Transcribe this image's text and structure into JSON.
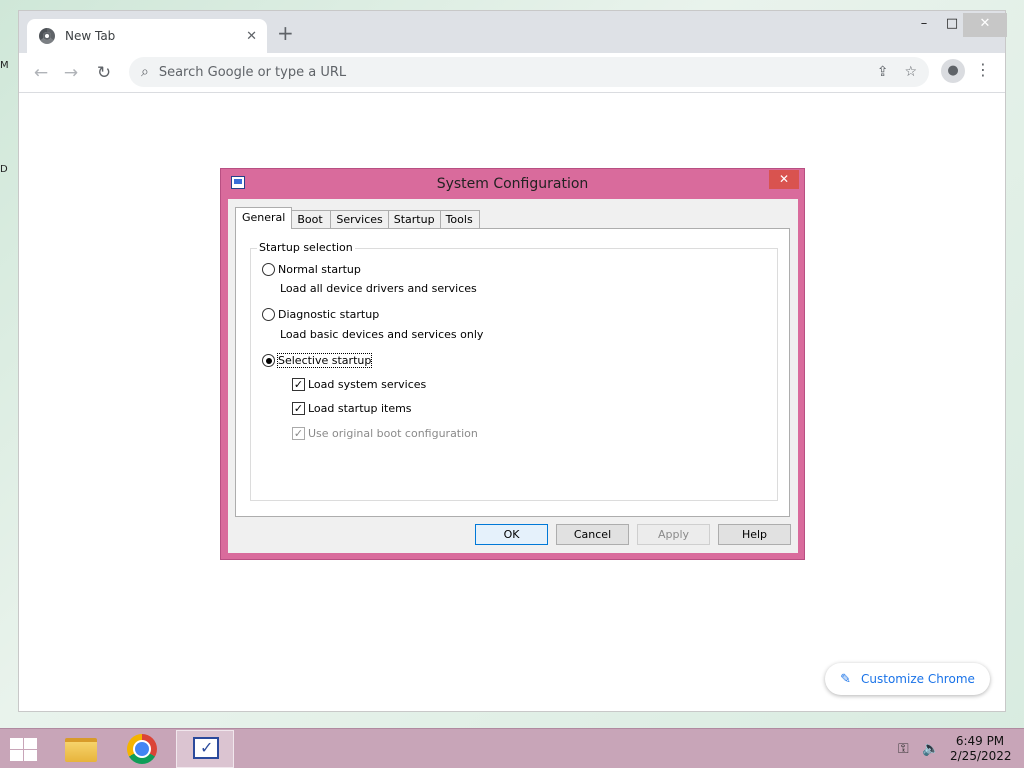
{
  "chrome": {
    "tab_title": "New Tab",
    "tab_close_glyph": "✕",
    "new_tab_glyph": "+",
    "window_controls": {
      "minimize": "–",
      "maximize": "□",
      "close": "✕"
    },
    "omnibox_placeholder": "Search Google or type a URL",
    "customize_label": "Customize Chrome",
    "icons": [
      "back-arrow-icon",
      "forward-arrow-icon",
      "reload-icon",
      "search-icon",
      "share-icon",
      "star-icon",
      "profile-icon",
      "more-menu-icon",
      "pencil-icon"
    ]
  },
  "dialog": {
    "title": "System Configuration",
    "close_glyph": "✕",
    "tabs": [
      "General",
      "Boot",
      "Services",
      "Startup",
      "Tools"
    ],
    "active_tab": "General",
    "group_label": "Startup selection",
    "options": {
      "normal": {
        "label": "Normal startup",
        "description": "Load all device drivers and services",
        "selected": false
      },
      "diagnostic": {
        "label": "Diagnostic startup",
        "description": "Load basic devices and services only",
        "selected": false
      },
      "selective": {
        "label": "Selective startup",
        "selected": true
      }
    },
    "checkboxes": {
      "system_services": {
        "label": "Load system services",
        "checked": true,
        "enabled": true
      },
      "startup_items": {
        "label": "Load startup items",
        "checked": true,
        "enabled": true
      },
      "boot_config": {
        "label": "Use original boot configuration",
        "checked": true,
        "enabled": false
      }
    },
    "buttons": {
      "ok": "OK",
      "cancel": "Cancel",
      "apply": "Apply",
      "help": "Help"
    }
  },
  "taskbar": {
    "time": "6:49 PM",
    "date": "2/25/2022",
    "items": [
      "file-explorer",
      "google-chrome",
      "system-configuration"
    ],
    "active_item": "system-configuration"
  },
  "colors": {
    "dialog_frame": "#d96b9c",
    "taskbar": "#c8a5b8",
    "chrome_tabstrip": "#dee1e6",
    "accent_blue": "#1a73e8"
  }
}
